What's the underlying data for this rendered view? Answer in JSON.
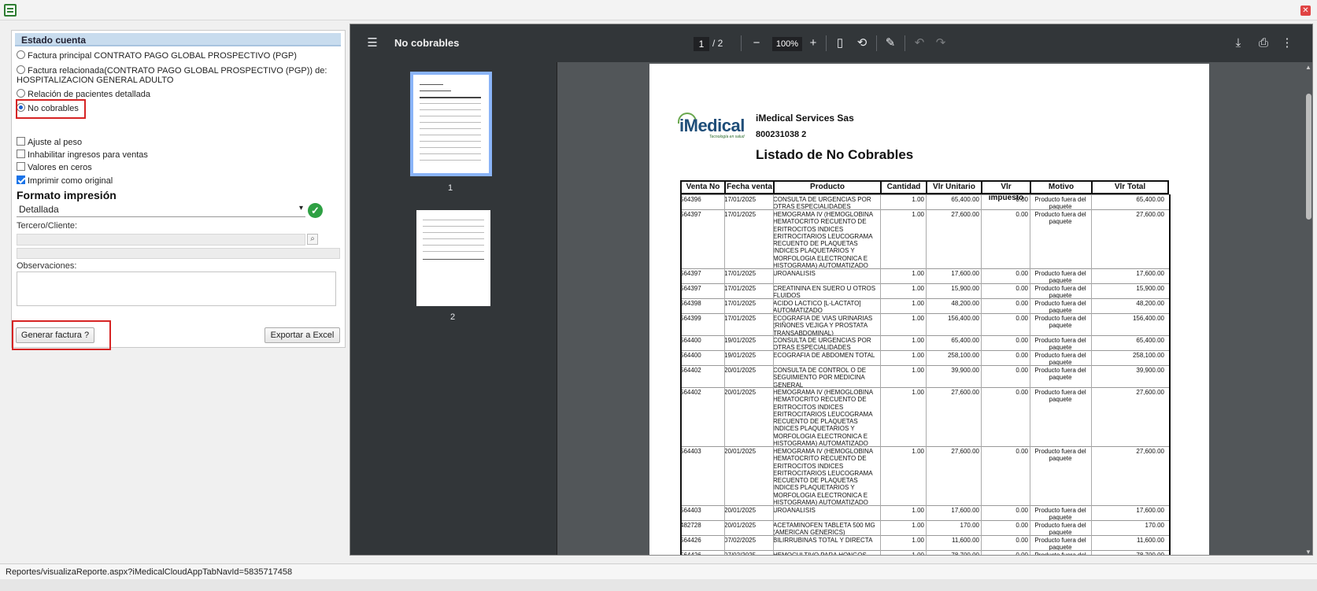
{
  "left_panel": {
    "section_header": "Estado cuenta",
    "options": [
      {
        "label": "Factura principal CONTRATO PAGO GLOBAL PROSPECTIVO (PGP)",
        "selected": false
      },
      {
        "label": "Factura relacionada(CONTRATO PAGO GLOBAL PROSPECTIVO (PGP)) de:",
        "label2": "HOSPITALIZACION GENERAL ADULTO",
        "selected": false
      },
      {
        "label": "Relación de pacientes detallada",
        "selected": false
      },
      {
        "label": "No cobrables",
        "selected": true
      }
    ],
    "checkboxes": [
      {
        "label": "Ajuste al peso",
        "checked": false
      },
      {
        "label": "Inhabilitar ingresos para ventas",
        "checked": false
      },
      {
        "label": "Valores en ceros",
        "checked": false
      },
      {
        "label": "Imprimir como original",
        "checked": true
      }
    ],
    "format_title": "Formato impresión",
    "format_value": "Detallada",
    "tercero_label": "Tercero/Cliente:",
    "observaciones_label": "Observaciones:",
    "generar_button": "Generar factura ?",
    "exportar_button": "Exportar a Excel"
  },
  "status_bar": {
    "url": "Reportes/visualizaReporte.aspx?iMedicalCloudAppTabNavId=5835717458"
  },
  "viewer": {
    "doc_title": "No cobrables",
    "current_page": "1",
    "total_pages": "/ 2",
    "zoom": "100%",
    "thumbnails": [
      "1",
      "2"
    ]
  },
  "report": {
    "logo": "iMedical",
    "logo_sub": "Tecnología en salud",
    "company": "iMedical Services Sas",
    "nit": "800231038 2",
    "title": "Listado de No Cobrables",
    "columns": [
      "Venta No",
      "Fecha venta",
      "Producto",
      "Cantidad",
      "Vlr Unitario",
      "Vlr impuesto",
      "Motivo",
      "Vlr Total"
    ],
    "rows": [
      [
        "564396",
        "17/01/2025",
        "CONSULTA DE URGENCIAS POR OTRAS ESPECIALIDADES MEDICAS",
        "1.00",
        "65,400.00",
        "0.00",
        "Producto fuera del paquete",
        "65,400.00"
      ],
      [
        "564397",
        "17/01/2025",
        "HEMOGRAMA IV (HEMOGLOBINA HEMATOCRITO RECUENTO DE ERITROCITOS INDICES ERITROCITARIOS LEUCOGRAMA RECUENTO DE PLAQUETAS INDICES PLAQUETARIOS Y MORFOLOGIA ELECTRONICA E HISTOGRAMA) AUTOMATIZADO",
        "1.00",
        "27,600.00",
        "0.00",
        "Producto fuera del paquete",
        "27,600.00"
      ],
      [
        "564397",
        "17/01/2025",
        "UROANALISIS",
        "1.00",
        "17,600.00",
        "0.00",
        "Producto fuera del paquete",
        "17,600.00"
      ],
      [
        "564397",
        "17/01/2025",
        "CREATININA EN SUERO U OTROS FLUIDOS",
        "1.00",
        "15,900.00",
        "0.00",
        "Producto fuera del paquete",
        "15,900.00"
      ],
      [
        "564398",
        "17/01/2025",
        "ACIDO LACTICO [L-LACTATO] AUTOMATIZADO",
        "1.00",
        "48,200.00",
        "0.00",
        "Producto fuera del paquete",
        "48,200.00"
      ],
      [
        "564399",
        "17/01/2025",
        "ECOGRAFIA DE VIAS URINARIAS (RIÑONES VEJIGA Y PROSTATA TRANSABDOMINAL)",
        "1.00",
        "156,400.00",
        "0.00",
        "Producto fuera del paquete",
        "156,400.00"
      ],
      [
        "564400",
        "19/01/2025",
        "CONSULTA DE URGENCIAS POR OTRAS ESPECIALIDADES MEDICAS",
        "1.00",
        "65,400.00",
        "0.00",
        "Producto fuera del paquete",
        "65,400.00"
      ],
      [
        "564400",
        "19/01/2025",
        "ECOGRAFIA DE ABDOMEN TOTAL",
        "1.00",
        "258,100.00",
        "0.00",
        "Producto fuera del paquete",
        "258,100.00"
      ],
      [
        "564402",
        "20/01/2025",
        "CONSULTA DE CONTROL O DE SEGUIMIENTO POR MEDICINA GENERAL",
        "1.00",
        "39,900.00",
        "0.00",
        "Producto fuera del paquete",
        "39,900.00"
      ],
      [
        "564402",
        "20/01/2025",
        "HEMOGRAMA IV (HEMOGLOBINA HEMATOCRITO RECUENTO DE ERITROCITOS INDICES ERITROCITARIOS LEUCOGRAMA RECUENTO DE PLAQUETAS INDICES PLAQUETARIOS Y MORFOLOGIA ELECTRONICA E HISTOGRAMA) AUTOMATIZADO",
        "1.00",
        "27,600.00",
        "0.00",
        "Producto fuera del paquete",
        "27,600.00"
      ],
      [
        "564403",
        "20/01/2025",
        "HEMOGRAMA IV (HEMOGLOBINA HEMATOCRITO RECUENTO DE ERITROCITOS INDICES ERITROCITARIOS LEUCOGRAMA RECUENTO DE PLAQUETAS INDICES PLAQUETARIOS Y MORFOLOGIA ELECTRONICA E HISTOGRAMA) AUTOMATIZADO",
        "1.00",
        "27,600.00",
        "0.00",
        "Producto fuera del paquete",
        "27,600.00"
      ],
      [
        "564403",
        "20/01/2025",
        "UROANALISIS",
        "1.00",
        "17,600.00",
        "0.00",
        "Producto fuera del paquete",
        "17,600.00"
      ],
      [
        "482728",
        "20/01/2025",
        "ACETAMINOFEN TABLETA 500 MG (AMERICAN GENERICS)",
        "1.00",
        "170.00",
        "0.00",
        "Producto fuera del paquete",
        "170.00"
      ],
      [
        "564426",
        "07/02/2025",
        "BILIRRUBINAS TOTAL Y DIRECTA",
        "1.00",
        "11,600.00",
        "0.00",
        "Producto fuera del paquete",
        "11,600.00"
      ],
      [
        "564426",
        "07/02/2025",
        "HEMOCULTIVO PARA HONGOS CADA",
        "1.00",
        "78,700.00",
        "0.00",
        "Producto fuera del",
        "78,700.00"
      ]
    ]
  }
}
